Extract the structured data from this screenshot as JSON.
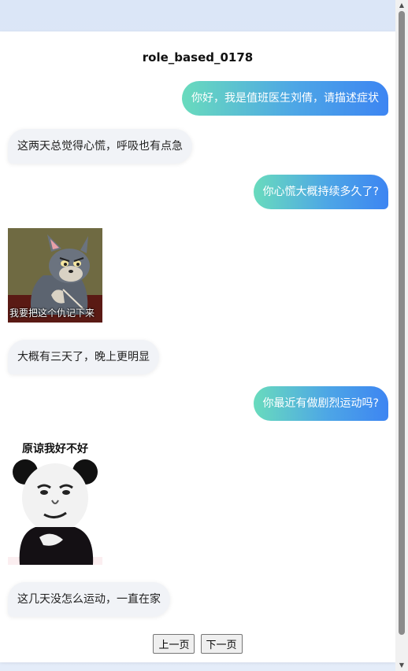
{
  "title": "role_based_0178",
  "messages": [
    {
      "role": "doctor",
      "text": "你好，我是值班医生刘倩，请描述症状"
    },
    {
      "role": "patient",
      "text": "这两天总觉得心慌，呼吸也有点急"
    },
    {
      "role": "doctor",
      "text": "你心慌大概持续多久了?"
    },
    {
      "role": "patient-sticker",
      "caption": "我要把这个仇记下来"
    },
    {
      "role": "patient",
      "text": "大概有三天了，晚上更明显"
    },
    {
      "role": "doctor",
      "text": "你最近有做剧烈运动吗?"
    },
    {
      "role": "patient-sticker",
      "caption": "原谅我好不好"
    },
    {
      "role": "patient",
      "text": "这几天没怎么运动，一直在家"
    }
  ],
  "pager": {
    "prev": "上一页",
    "next": "下一页"
  },
  "colors": {
    "doctor_gradient_start": "#69dbbd",
    "doctor_gradient_end": "#3d85f2",
    "patient_bubble": "#f1f3f7"
  }
}
